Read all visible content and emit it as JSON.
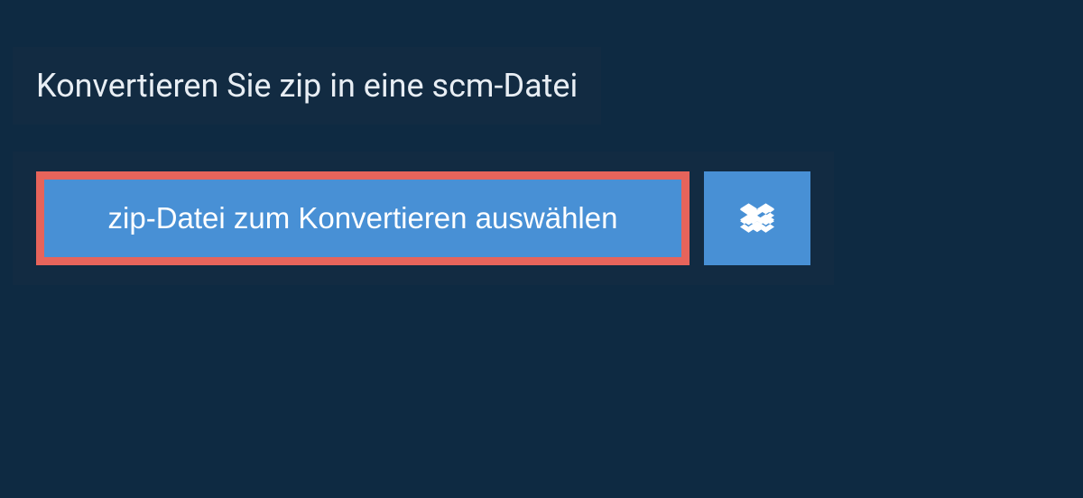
{
  "header": {
    "title": "Konvertieren Sie zip in eine scm-Datei"
  },
  "upload": {
    "select_button_label": "zip-Datei zum Konvertieren auswählen"
  },
  "colors": {
    "background": "#0e2a42",
    "panel": "#122b42",
    "button_primary": "#4890d5",
    "button_highlight_border": "#e6645b",
    "text_light": "#e8eef4"
  }
}
